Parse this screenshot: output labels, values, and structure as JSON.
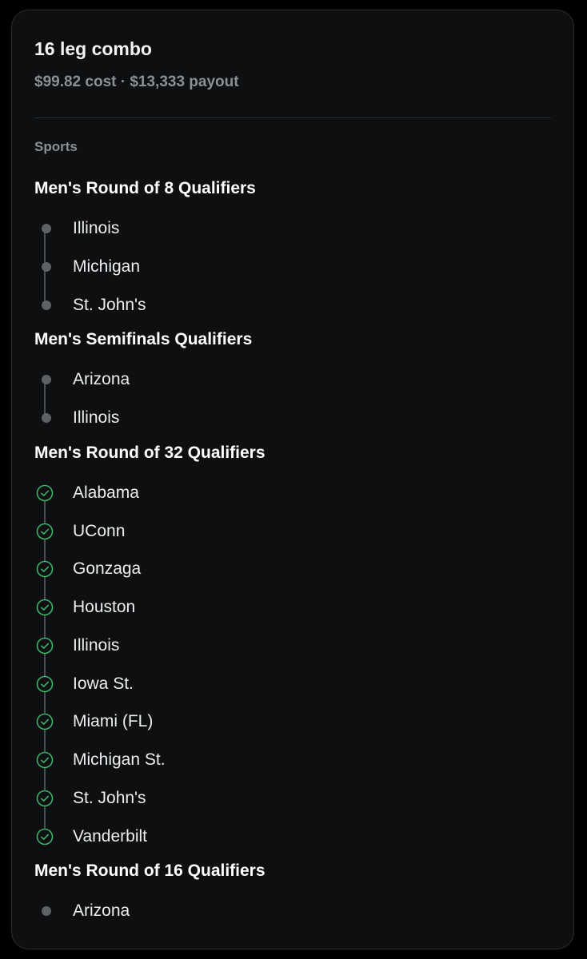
{
  "card": {
    "title": "16 leg combo",
    "subtitle": "$99.82 cost · $13,333 payout",
    "section_label": "Sports"
  },
  "colors": {
    "card_bg": "#0d0f10",
    "pending_dot": "#5e6166",
    "check_green": "#3db36a",
    "connector": "#4a4d52"
  },
  "groups": [
    {
      "title": "Men's Round of 8 Qualifiers",
      "items": [
        {
          "label": "Illinois",
          "status": "pending",
          "icon": "pending-dot-icon"
        },
        {
          "label": "Michigan",
          "status": "pending",
          "icon": "pending-dot-icon"
        },
        {
          "label": "St. John's",
          "status": "pending",
          "icon": "pending-dot-icon"
        }
      ]
    },
    {
      "title": "Men's Semifinals Qualifiers",
      "items": [
        {
          "label": "Arizona",
          "status": "pending",
          "icon": "pending-dot-icon"
        },
        {
          "label": "Illinois",
          "status": "pending",
          "icon": "pending-dot-icon"
        }
      ]
    },
    {
      "title": "Men's Round of 32 Qualifiers",
      "items": [
        {
          "label": "Alabama",
          "status": "won",
          "icon": "check-circle-icon"
        },
        {
          "label": "UConn",
          "status": "won",
          "icon": "check-circle-icon"
        },
        {
          "label": "Gonzaga",
          "status": "won",
          "icon": "check-circle-icon"
        },
        {
          "label": "Houston",
          "status": "won",
          "icon": "check-circle-icon"
        },
        {
          "label": "Illinois",
          "status": "won",
          "icon": "check-circle-icon"
        },
        {
          "label": "Iowa St.",
          "status": "won",
          "icon": "check-circle-icon"
        },
        {
          "label": "Miami (FL)",
          "status": "won",
          "icon": "check-circle-icon"
        },
        {
          "label": "Michigan St.",
          "status": "won",
          "icon": "check-circle-icon"
        },
        {
          "label": "St. John's",
          "status": "won",
          "icon": "check-circle-icon"
        },
        {
          "label": "Vanderbilt",
          "status": "won",
          "icon": "check-circle-icon"
        }
      ]
    },
    {
      "title": "Men's Round of 16 Qualifiers",
      "items": [
        {
          "label": "Arizona",
          "status": "pending",
          "icon": "pending-dot-icon"
        }
      ]
    }
  ]
}
